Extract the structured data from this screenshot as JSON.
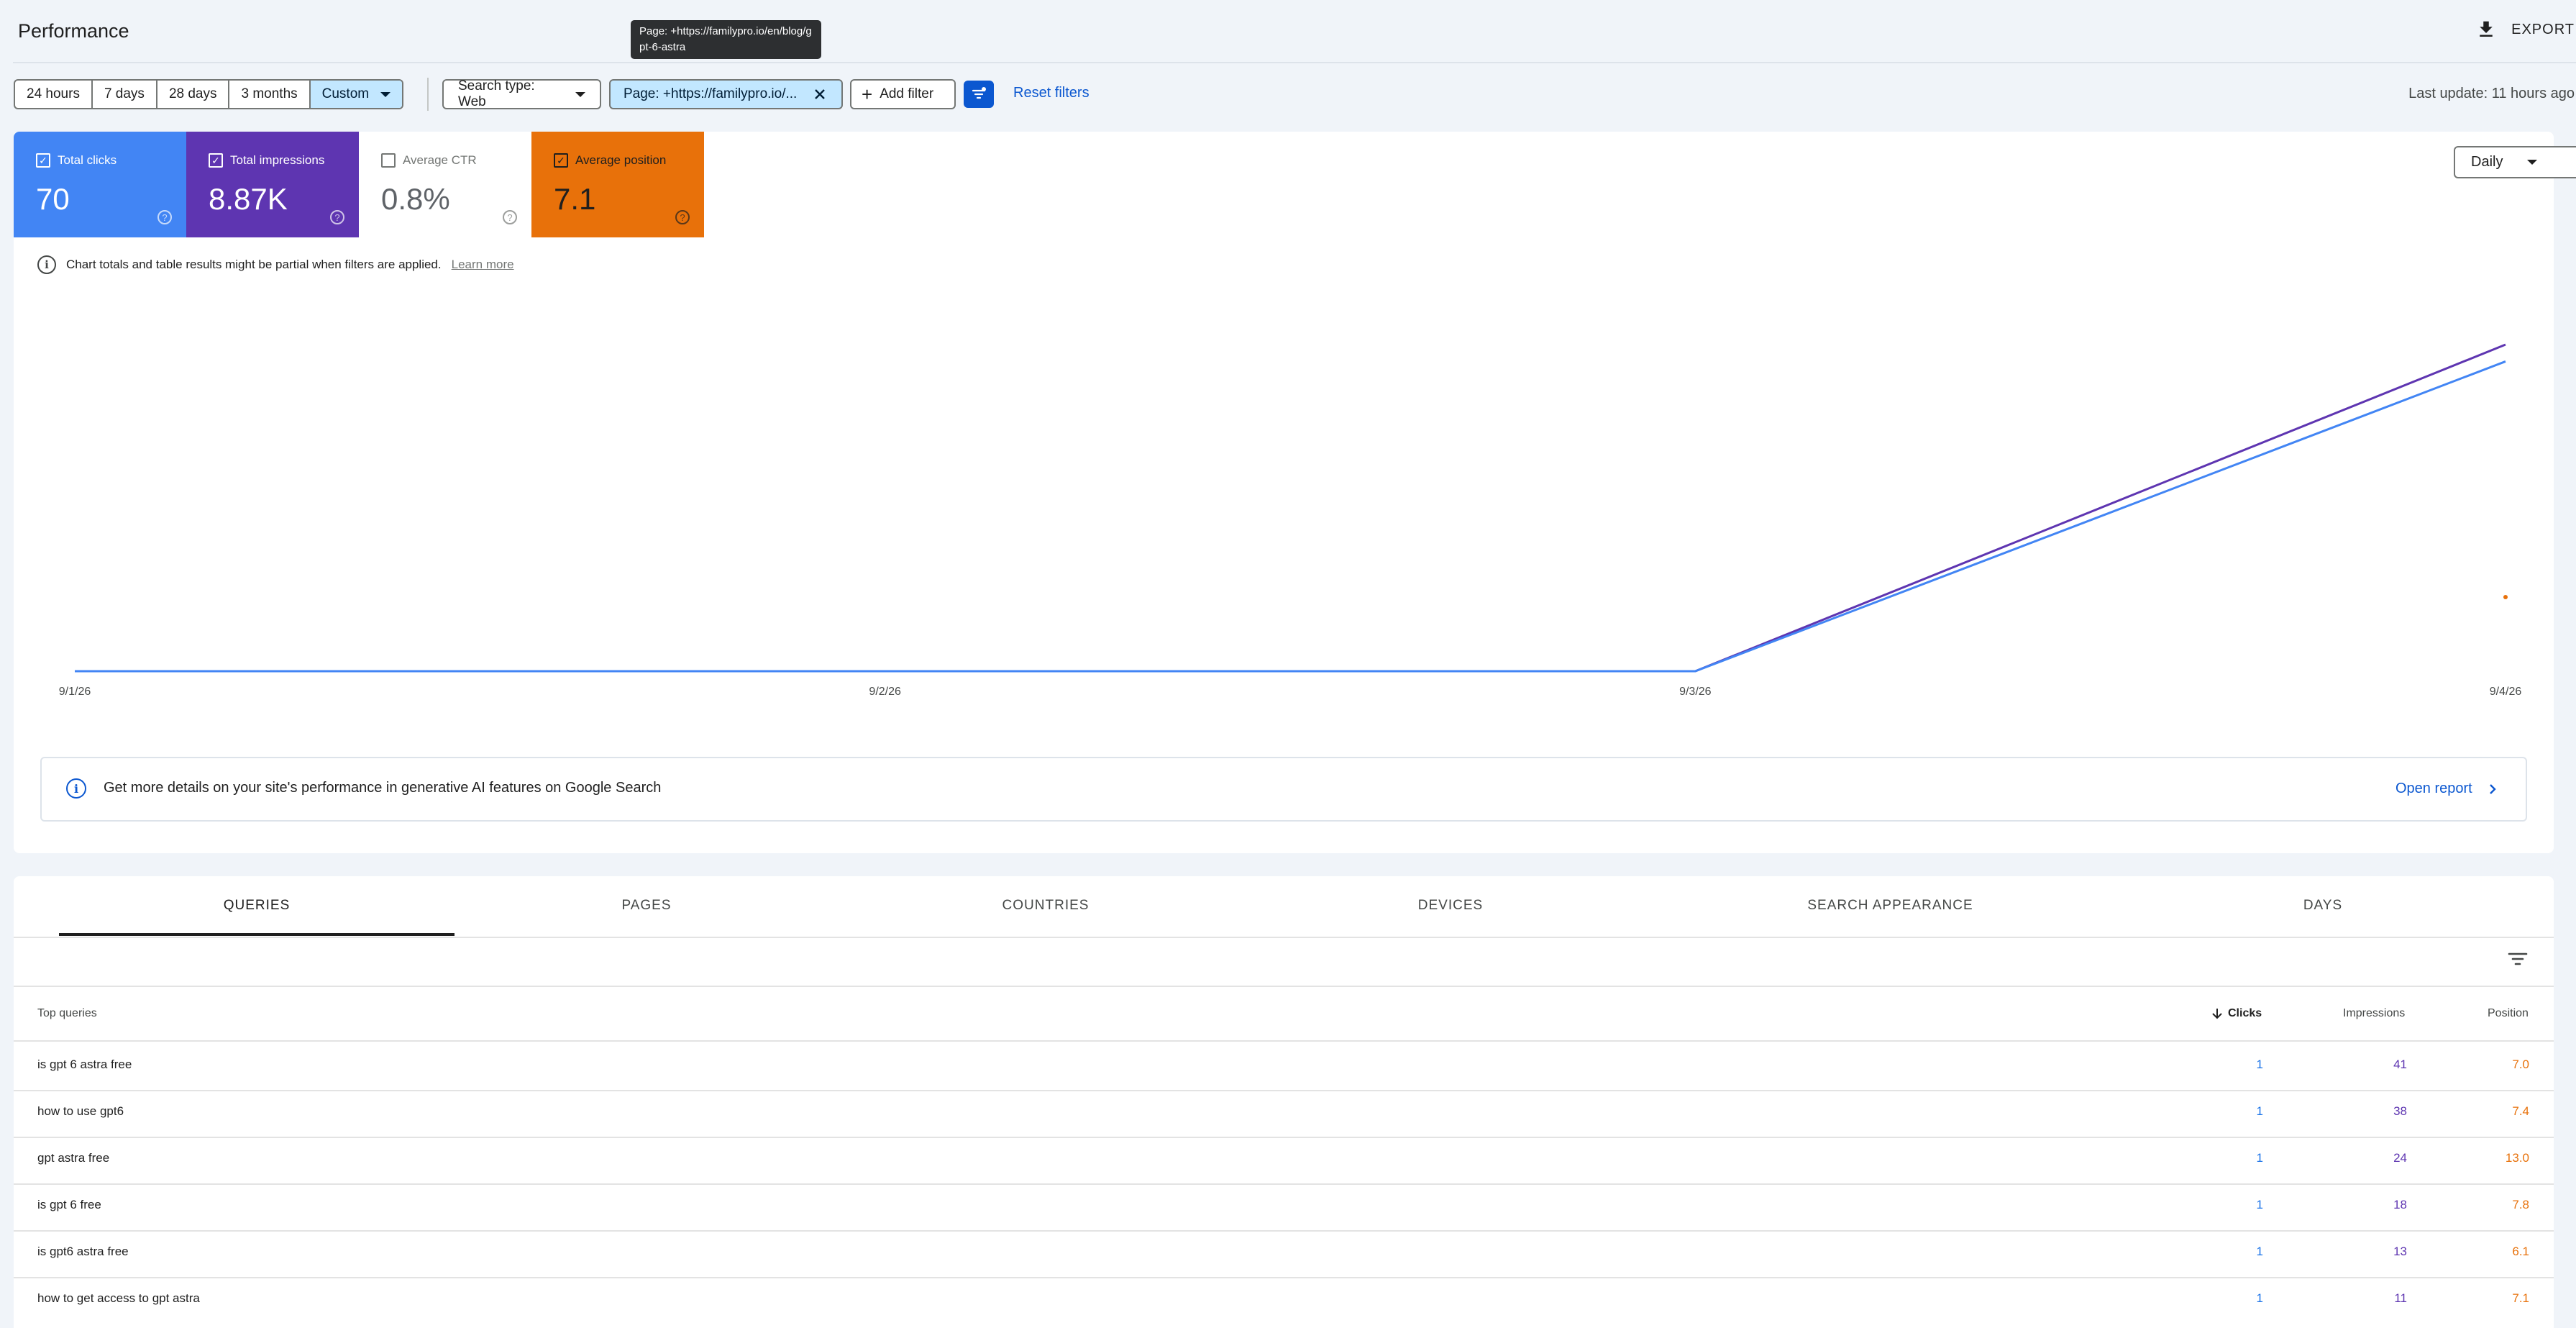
{
  "header": {
    "title": "Performance",
    "export_label": "EXPORT"
  },
  "tooltip": {
    "text": "Page: +https://familypro.io/en/blog/gpt-6-astra"
  },
  "date_ranges": [
    "24 hours",
    "7 days",
    "28 days",
    "3 months",
    "Custom"
  ],
  "filters": {
    "search_type": "Search type: Web",
    "page": "Page: +https://familypro.io/...",
    "add_filter": "Add filter",
    "reset": "Reset filters"
  },
  "last_update": "Last update: 11 hours ago",
  "metrics": {
    "clicks": {
      "label": "Total clicks",
      "value": "70",
      "checked": true
    },
    "impressions": {
      "label": "Total impressions",
      "value": "8.87K",
      "checked": true
    },
    "ctr": {
      "label": "Average CTR",
      "value": "0.8%",
      "checked": false
    },
    "position": {
      "label": "Average position",
      "value": "7.1",
      "checked": true
    }
  },
  "granularity": "Daily",
  "notice": {
    "text": "Chart totals and table results might be partial when filters are applied.",
    "link": "Learn more"
  },
  "chart_data": {
    "type": "line",
    "x": [
      "9/1/26",
      "9/2/26",
      "9/3/26",
      "9/4/26"
    ],
    "series": [
      {
        "values": [
          0,
          0,
          0,
          70
        ]
      },
      {
        "values": [
          0,
          0,
          0,
          8870
        ]
      },
      {
        "values": [
          null,
          null,
          null,
          7.1
        ]
      }
    ]
  },
  "ai_banner": {
    "text": "Get more details on your site's performance in generative AI features on Google Search",
    "link": "Open report"
  },
  "tabs": [
    "QUERIES",
    "PAGES",
    "COUNTRIES",
    "DEVICES",
    "SEARCH APPEARANCE",
    "DAYS"
  ],
  "table": {
    "headers": {
      "query": "Top queries",
      "clicks": "Clicks",
      "impressions": "Impressions",
      "position": "Position"
    },
    "rows": [
      {
        "query": "is gpt 6 astra free",
        "clicks": "1",
        "impressions": "41",
        "position": "7.0"
      },
      {
        "query": "how to use gpt6",
        "clicks": "1",
        "impressions": "38",
        "position": "7.4"
      },
      {
        "query": "gpt astra free",
        "clicks": "1",
        "impressions": "24",
        "position": "13.0"
      },
      {
        "query": "is gpt 6 free",
        "clicks": "1",
        "impressions": "18",
        "position": "7.8"
      },
      {
        "query": "is gpt6 astra free",
        "clicks": "1",
        "impressions": "13",
        "position": "6.1"
      },
      {
        "query": "how to get access to gpt astra",
        "clicks": "1",
        "impressions": "11",
        "position": "7.1"
      }
    ]
  },
  "colors": {
    "clicks": "#4285f4",
    "impressions": "#5e35b1",
    "ctr": "#747775",
    "position": "#e8710a",
    "accent": "#0b57d0"
  }
}
